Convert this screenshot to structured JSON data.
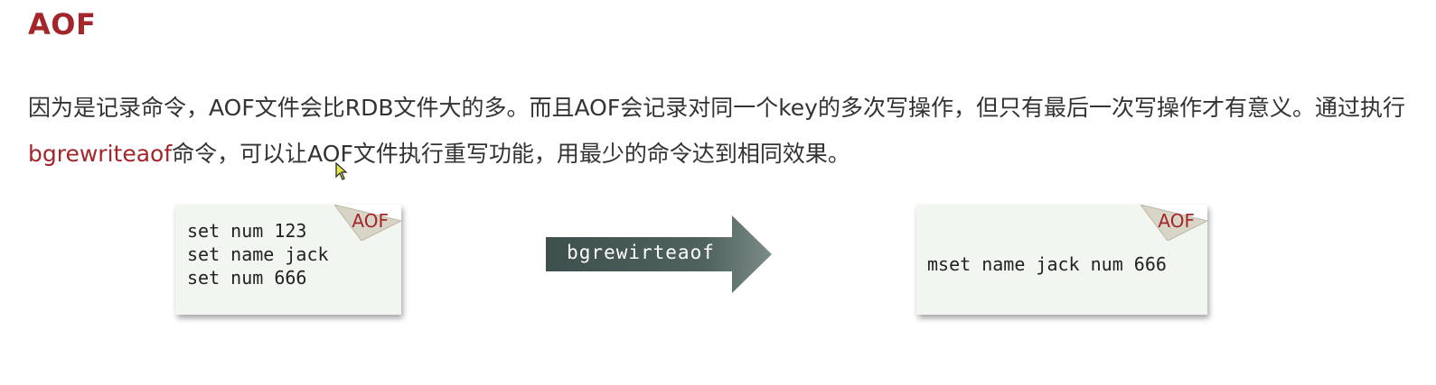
{
  "slide": {
    "title": "AOF",
    "paragraph": {
      "before": "因为是记录命令，AOF文件会比RDB文件大的多。而且AOF会记录对同一个key的多次写操作，但只有最后一次写操作才有意义。通过执行",
      "highlight": "bgrewriteaof",
      "after": "命令，可以让AOF文件执行重写功能，用最少的命令达到相同效果。"
    }
  },
  "before_card": {
    "tag": "AOF",
    "lines": [
      "set num 123",
      "set name jack",
      "set num 666"
    ]
  },
  "arrow": {
    "label": "bgrewirteaof"
  },
  "after_card": {
    "tag": "AOF",
    "lines": [
      "mset name jack num 666"
    ]
  },
  "colors": {
    "accent": "#a3262b",
    "card_bg": "#f2f6f0",
    "arrow_dark": "#3e504d",
    "arrow_light": "#6b7c78"
  }
}
